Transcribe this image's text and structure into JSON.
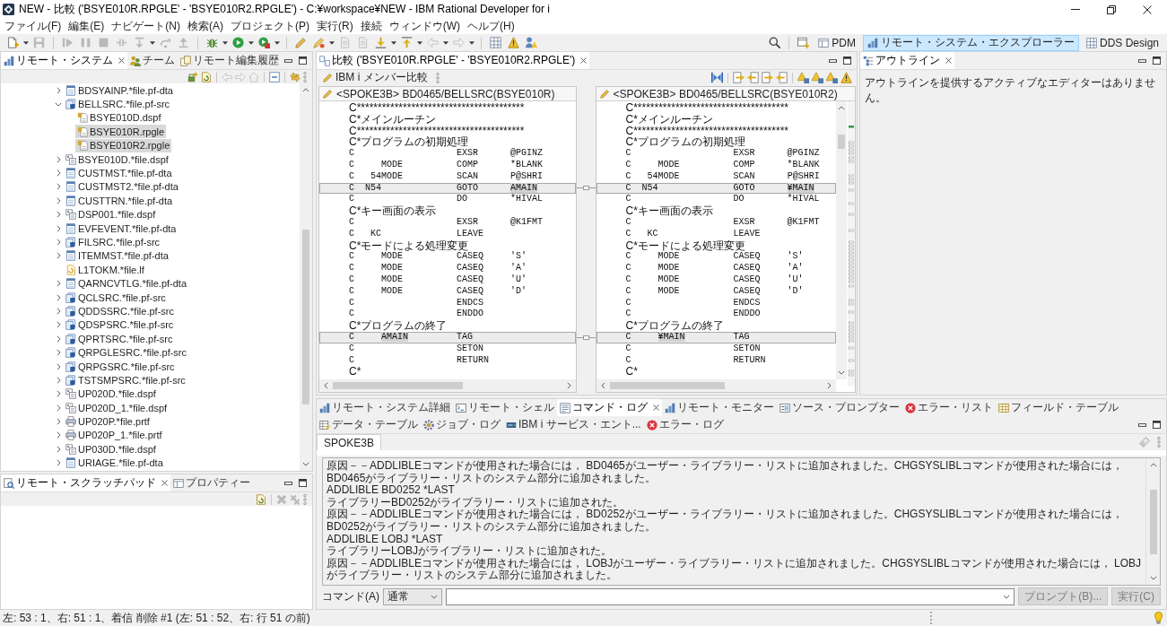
{
  "window": {
    "title": "NEW - 比較 ('BSYE010R.RPGLE' - 'BSYE010R2.RPGLE') - C:¥workspace¥NEW - IBM Rational Developer for i"
  },
  "menu": [
    "ファイル(F)",
    "編集(E)",
    "ナビゲート(N)",
    "検索(A)",
    "プロジェクト(P)",
    "実行(R)",
    "接続",
    "ウィンドウ(W)",
    "ヘルプ(H)"
  ],
  "toolbar": {
    "perspectives": [
      {
        "label": "PDM",
        "selected": false
      },
      {
        "label": "リモート・システム・エクスプローラー",
        "selected": true
      },
      {
        "label": "DDS Design",
        "selected": false
      }
    ]
  },
  "left_panel": {
    "tabs": [
      {
        "label": "リモート・システム",
        "selected": true
      },
      {
        "label": "チーム",
        "selected": false
      },
      {
        "label": "リモート編集履歴",
        "selected": false
      }
    ],
    "tree": [
      {
        "label": "BDSYAINP.*file.pf-dta",
        "kind": "data",
        "expanded": false,
        "selected": false
      },
      {
        "label": "BELLSRC.*file.pf-src",
        "kind": "source",
        "expanded": true,
        "selected": false,
        "children": [
          {
            "label": "BSYE010D.dspf",
            "kind": "member",
            "selected": false
          },
          {
            "label": "BSYE010R.rpgle",
            "kind": "member",
            "selected": true
          },
          {
            "label": "BSYE010R2.rpgle",
            "kind": "member",
            "selected": true
          }
        ]
      },
      {
        "label": "BSYE010D.*file.dspf",
        "kind": "display",
        "expanded": false,
        "selected": false
      },
      {
        "label": "CUSTMST.*file.pf-dta",
        "kind": "data",
        "expanded": false,
        "selected": false
      },
      {
        "label": "CUSTMST2.*file.pf-dta",
        "kind": "data",
        "expanded": false,
        "selected": false
      },
      {
        "label": "CUSTTRN.*file.pf-dta",
        "kind": "data",
        "expanded": false,
        "selected": false
      },
      {
        "label": "DSP001.*file.dspf",
        "kind": "display",
        "expanded": false,
        "selected": false
      },
      {
        "label": "EVFEVENT.*file.pf-dta",
        "kind": "data",
        "expanded": false,
        "selected": false
      },
      {
        "label": "FILSRC.*file.pf-src",
        "kind": "source",
        "expanded": false,
        "selected": false
      },
      {
        "label": "ITEMMST.*file.pf-dta",
        "kind": "data",
        "expanded": false,
        "selected": false
      },
      {
        "label": "L1TOKM.*file.lf",
        "kind": "logical",
        "selected": false
      },
      {
        "label": "QARNCVTLG.*file.pf-dta",
        "kind": "data",
        "expanded": false,
        "selected": false
      },
      {
        "label": "QCLSRC.*file.pf-src",
        "kind": "source",
        "expanded": false,
        "selected": false
      },
      {
        "label": "QDDSSRC.*file.pf-src",
        "kind": "source",
        "expanded": false,
        "selected": false
      },
      {
        "label": "QDSPSRC.*file.pf-src",
        "kind": "source",
        "expanded": false,
        "selected": false
      },
      {
        "label": "QPRTSRC.*file.pf-src",
        "kind": "source",
        "expanded": false,
        "selected": false
      },
      {
        "label": "QRPGLESRC.*file.pf-src",
        "kind": "source",
        "expanded": false,
        "selected": false
      },
      {
        "label": "QRPGSRC.*file.pf-src",
        "kind": "source",
        "expanded": false,
        "selected": false
      },
      {
        "label": "TSTSMPSRC.*file.pf-src",
        "kind": "source",
        "expanded": false,
        "selected": false
      },
      {
        "label": "UP020D.*file.dspf",
        "kind": "display",
        "expanded": false,
        "selected": false
      },
      {
        "label": "UP020D_1.*file.dspf",
        "kind": "display",
        "expanded": false,
        "selected": false
      },
      {
        "label": "UP020P.*file.prtf",
        "kind": "printer",
        "expanded": false,
        "selected": false
      },
      {
        "label": "UP020P_1.*file.prtf",
        "kind": "printer",
        "expanded": false,
        "selected": false
      },
      {
        "label": "UP030D.*file.dspf",
        "kind": "display",
        "expanded": false,
        "selected": false
      },
      {
        "label": "URIAGE.*file.pf-dta",
        "kind": "data",
        "expanded": false,
        "selected": false
      }
    ]
  },
  "scratch_panel": {
    "tabs": [
      {
        "label": "リモート・スクラッチパッド",
        "selected": true
      },
      {
        "label": "プロパティー",
        "selected": false
      }
    ]
  },
  "compare_editor": {
    "tabs": [
      {
        "label": "比較 ('BSYE010R.RPGLE' - 'BSYE010R2.RPGLE')",
        "selected": true
      }
    ],
    "title": "IBM i メンバー比較",
    "panes": [
      {
        "header": "<SPOKE3B> BD0465/BELLSRC(BSYE010R)",
        "lines": [
          {
            "kind": "comment",
            "text": "C****************************************",
            "changed": false
          },
          {
            "kind": "comment",
            "text": "C*メインルーチン",
            "changed": false
          },
          {
            "kind": "comment",
            "text": "C****************************************",
            "changed": false
          },
          {
            "kind": "comment",
            "text": "C*プログラムの初期処理",
            "changed": false
          },
          {
            "kind": "calc",
            "changed": false,
            "tokens": [
              {
                "kind": "spec",
                "text": "C",
                "differs": false
              },
              {
                "kind": "opcode",
                "text": "EXSR",
                "differs": false
              },
              {
                "kind": "factor2",
                "text": "@PGINZ",
                "differs": false
              }
            ]
          },
          {
            "kind": "calc",
            "changed": false,
            "tokens": [
              {
                "kind": "spec",
                "text": "C",
                "differs": false
              },
              {
                "kind": "factor1",
                "text": "MODE",
                "differs": false
              },
              {
                "kind": "opcode",
                "text": "COMP",
                "differs": false
              },
              {
                "kind": "factor2",
                "text": "*BLANK",
                "differs": false
              }
            ]
          },
          {
            "kind": "calc",
            "changed": false,
            "tokens": [
              {
                "kind": "spec",
                "text": "C",
                "differs": false
              },
              {
                "kind": "indicator",
                "text": "54",
                "differs": false
              },
              {
                "kind": "factor1",
                "text": "MODE",
                "differs": false
              },
              {
                "kind": "opcode",
                "text": "SCAN",
                "differs": false
              },
              {
                "kind": "factor2",
                "text": "P@SHRI",
                "differs": false
              }
            ]
          },
          {
            "kind": "calc",
            "changed": true,
            "tokens": [
              {
                "kind": "spec",
                "text": "C",
                "differs": false
              },
              {
                "kind": "indicator",
                "text": "N54",
                "differs": false
              },
              {
                "kind": "opcode",
                "text": "GOTO",
                "differs": false
              },
              {
                "kind": "factor2",
                "text": "AMAIN",
                "differs": true
              }
            ]
          },
          {
            "kind": "calc",
            "changed": false,
            "tokens": [
              {
                "kind": "spec",
                "text": "C",
                "differs": false
              },
              {
                "kind": "opcode",
                "text": "DO",
                "differs": false
              },
              {
                "kind": "factor2",
                "text": "*HIVAL",
                "differs": false
              }
            ]
          },
          {
            "kind": "comment",
            "text": "C*キー画面の表示",
            "changed": false
          },
          {
            "kind": "calc",
            "changed": false,
            "tokens": [
              {
                "kind": "spec",
                "text": "C",
                "differs": false
              },
              {
                "kind": "opcode",
                "text": "EXSR",
                "differs": false
              },
              {
                "kind": "factor2",
                "text": "@K1FMT",
                "differs": false
              }
            ]
          },
          {
            "kind": "calc",
            "changed": false,
            "tokens": [
              {
                "kind": "spec",
                "text": "C",
                "differs": false
              },
              {
                "kind": "indicator",
                "text": "KC",
                "differs": false
              },
              {
                "kind": "opcode",
                "text": "LEAVE",
                "differs": false
              }
            ]
          },
          {
            "kind": "comment",
            "text": "C*モードによる処理変更",
            "changed": false
          },
          {
            "kind": "calc",
            "changed": false,
            "tokens": [
              {
                "kind": "spec",
                "text": "C",
                "differs": false
              },
              {
                "kind": "factor1",
                "text": "MODE",
                "differs": false
              },
              {
                "kind": "opcode",
                "text": "CASEQ",
                "differs": false
              },
              {
                "kind": "factor2",
                "text": "'S'",
                "differs": false
              }
            ]
          },
          {
            "kind": "calc",
            "changed": false,
            "tokens": [
              {
                "kind": "spec",
                "text": "C",
                "differs": false
              },
              {
                "kind": "factor1",
                "text": "MODE",
                "differs": false
              },
              {
                "kind": "opcode",
                "text": "CASEQ",
                "differs": false
              },
              {
                "kind": "factor2",
                "text": "'A'",
                "differs": false
              }
            ]
          },
          {
            "kind": "calc",
            "changed": false,
            "tokens": [
              {
                "kind": "spec",
                "text": "C",
                "differs": false
              },
              {
                "kind": "factor1",
                "text": "MODE",
                "differs": false
              },
              {
                "kind": "opcode",
                "text": "CASEQ",
                "differs": false
              },
              {
                "kind": "factor2",
                "text": "'U'",
                "differs": false
              }
            ]
          },
          {
            "kind": "calc",
            "changed": false,
            "tokens": [
              {
                "kind": "spec",
                "text": "C",
                "differs": false
              },
              {
                "kind": "factor1",
                "text": "MODE",
                "differs": false
              },
              {
                "kind": "opcode",
                "text": "CASEQ",
                "differs": false
              },
              {
                "kind": "factor2",
                "text": "'D'",
                "differs": false
              }
            ]
          },
          {
            "kind": "calc",
            "changed": false,
            "tokens": [
              {
                "kind": "spec",
                "text": "C",
                "differs": false
              },
              {
                "kind": "opcode",
                "text": "ENDCS",
                "differs": false
              }
            ]
          },
          {
            "kind": "calc",
            "changed": false,
            "tokens": [
              {
                "kind": "spec",
                "text": "C",
                "differs": false
              },
              {
                "kind": "opcode",
                "text": "ENDDO",
                "differs": false
              }
            ]
          },
          {
            "kind": "comment",
            "text": "C*プログラムの終了",
            "changed": false
          },
          {
            "kind": "calc",
            "changed": true,
            "tokens": [
              {
                "kind": "spec",
                "text": "C",
                "differs": false
              },
              {
                "kind": "factor1",
                "text": "AMAIN",
                "differs": true
              },
              {
                "kind": "opcode",
                "text": "TAG",
                "differs": false
              }
            ]
          },
          {
            "kind": "calc",
            "changed": false,
            "tokens": [
              {
                "kind": "spec",
                "text": "C",
                "differs": false
              },
              {
                "kind": "opcode",
                "text": "SETON",
                "differs": false
              }
            ]
          },
          {
            "kind": "calc",
            "changed": false,
            "tokens": [
              {
                "kind": "spec",
                "text": "C",
                "differs": false
              },
              {
                "kind": "opcode",
                "text": "RETURN",
                "differs": false
              }
            ]
          },
          {
            "kind": "comment",
            "text": "C*",
            "changed": false
          }
        ]
      },
      {
        "header": "<SPOKE3B> BD0465/BELLSRC(BSYE010R2)",
        "lines": [
          {
            "kind": "comment",
            "text": "C*************************************",
            "changed": false
          },
          {
            "kind": "comment",
            "text": "C*メインルーチン",
            "changed": false
          },
          {
            "kind": "comment",
            "text": "C*************************************",
            "changed": false
          },
          {
            "kind": "comment",
            "text": "C*プログラムの初期処理",
            "changed": false
          },
          {
            "kind": "calc",
            "changed": false,
            "tokens": [
              {
                "kind": "spec",
                "text": "C",
                "differs": false
              },
              {
                "kind": "opcode",
                "text": "EXSR",
                "differs": false
              },
              {
                "kind": "factor2",
                "text": "@PGINZ",
                "differs": false
              }
            ]
          },
          {
            "kind": "calc",
            "changed": false,
            "tokens": [
              {
                "kind": "spec",
                "text": "C",
                "differs": false
              },
              {
                "kind": "factor1",
                "text": "MODE",
                "differs": false
              },
              {
                "kind": "opcode",
                "text": "COMP",
                "differs": false
              },
              {
                "kind": "factor2",
                "text": "*BLANK",
                "differs": false
              }
            ]
          },
          {
            "kind": "calc",
            "changed": false,
            "tokens": [
              {
                "kind": "spec",
                "text": "C",
                "differs": false
              },
              {
                "kind": "indicator",
                "text": "54",
                "differs": false
              },
              {
                "kind": "factor1",
                "text": "MODE",
                "differs": false
              },
              {
                "kind": "opcode",
                "text": "SCAN",
                "differs": false
              },
              {
                "kind": "factor2",
                "text": "P@SHRI",
                "differs": false
              }
            ]
          },
          {
            "kind": "calc",
            "changed": true,
            "tokens": [
              {
                "kind": "spec",
                "text": "C",
                "differs": false
              },
              {
                "kind": "indicator",
                "text": "N54",
                "differs": false
              },
              {
                "kind": "opcode",
                "text": "GOTO",
                "differs": false
              },
              {
                "kind": "factor2",
                "text": "¥MAIN",
                "differs": true
              }
            ]
          },
          {
            "kind": "calc",
            "changed": false,
            "tokens": [
              {
                "kind": "spec",
                "text": "C",
                "differs": false
              },
              {
                "kind": "opcode",
                "text": "DO",
                "differs": false
              },
              {
                "kind": "factor2",
                "text": "*HIVAL",
                "differs": false
              }
            ]
          },
          {
            "kind": "comment",
            "text": "C*キー画面の表示",
            "changed": false
          },
          {
            "kind": "calc",
            "changed": false,
            "tokens": [
              {
                "kind": "spec",
                "text": "C",
                "differs": false
              },
              {
                "kind": "opcode",
                "text": "EXSR",
                "differs": false
              },
              {
                "kind": "factor2",
                "text": "@K1FMT",
                "differs": false
              }
            ]
          },
          {
            "kind": "calc",
            "changed": false,
            "tokens": [
              {
                "kind": "spec",
                "text": "C",
                "differs": false
              },
              {
                "kind": "indicator",
                "text": "KC",
                "differs": false
              },
              {
                "kind": "opcode",
                "text": "LEAVE",
                "differs": false
              }
            ]
          },
          {
            "kind": "comment",
            "text": "C*モードによる処理変更",
            "changed": false
          },
          {
            "kind": "calc",
            "changed": false,
            "tokens": [
              {
                "kind": "spec",
                "text": "C",
                "differs": false
              },
              {
                "kind": "factor1",
                "text": "MODE",
                "differs": false
              },
              {
                "kind": "opcode",
                "text": "CASEQ",
                "differs": false
              },
              {
                "kind": "factor2",
                "text": "'S'",
                "differs": false
              }
            ]
          },
          {
            "kind": "calc",
            "changed": false,
            "tokens": [
              {
                "kind": "spec",
                "text": "C",
                "differs": false
              },
              {
                "kind": "factor1",
                "text": "MODE",
                "differs": false
              },
              {
                "kind": "opcode",
                "text": "CASEQ",
                "differs": false
              },
              {
                "kind": "factor2",
                "text": "'A'",
                "differs": false
              }
            ]
          },
          {
            "kind": "calc",
            "changed": false,
            "tokens": [
              {
                "kind": "spec",
                "text": "C",
                "differs": false
              },
              {
                "kind": "factor1",
                "text": "MODE",
                "differs": false
              },
              {
                "kind": "opcode",
                "text": "CASEQ",
                "differs": false
              },
              {
                "kind": "factor2",
                "text": "'U'",
                "differs": false
              }
            ]
          },
          {
            "kind": "calc",
            "changed": false,
            "tokens": [
              {
                "kind": "spec",
                "text": "C",
                "differs": false
              },
              {
                "kind": "factor1",
                "text": "MODE",
                "differs": false
              },
              {
                "kind": "opcode",
                "text": "CASEQ",
                "differs": false
              },
              {
                "kind": "factor2",
                "text": "'D'",
                "differs": false
              }
            ]
          },
          {
            "kind": "calc",
            "changed": false,
            "tokens": [
              {
                "kind": "spec",
                "text": "C",
                "differs": false
              },
              {
                "kind": "opcode",
                "text": "ENDCS",
                "differs": false
              }
            ]
          },
          {
            "kind": "calc",
            "changed": false,
            "tokens": [
              {
                "kind": "spec",
                "text": "C",
                "differs": false
              },
              {
                "kind": "opcode",
                "text": "ENDDO",
                "differs": false
              }
            ]
          },
          {
            "kind": "comment",
            "text": "C*プログラムの終了",
            "changed": false
          },
          {
            "kind": "calc",
            "changed": true,
            "tokens": [
              {
                "kind": "spec",
                "text": "C",
                "differs": false
              },
              {
                "kind": "factor1",
                "text": "¥MAIN",
                "differs": true
              },
              {
                "kind": "opcode",
                "text": "TAG",
                "differs": false
              }
            ]
          },
          {
            "kind": "calc",
            "changed": false,
            "tokens": [
              {
                "kind": "spec",
                "text": "C",
                "differs": false
              },
              {
                "kind": "opcode",
                "text": "SETON",
                "differs": false
              }
            ]
          },
          {
            "kind": "calc",
            "changed": false,
            "tokens": [
              {
                "kind": "spec",
                "text": "C",
                "differs": false
              },
              {
                "kind": "opcode",
                "text": "RETURN",
                "differs": false
              }
            ]
          },
          {
            "kind": "comment",
            "text": "C*",
            "changed": false
          }
        ]
      }
    ]
  },
  "outline_panel": {
    "tabs": [
      {
        "label": "アウトライン",
        "selected": true
      }
    ],
    "message": "アウトラインを提供するアクティブなエディターはありません。"
  },
  "console_panel": {
    "tabs": [
      {
        "label": "リモート・システム詳細",
        "selected": false
      },
      {
        "label": "リモート・シェル",
        "selected": false
      },
      {
        "label": "コマンド・ログ",
        "selected": true
      },
      {
        "label": "リモート・モニター",
        "selected": false
      },
      {
        "label": "ソース・プロンプター",
        "selected": false
      },
      {
        "label": "エラー・リスト",
        "selected": false
      },
      {
        "label": "フィールド・テーブル",
        "selected": false
      },
      {
        "label": "データ・テーブル",
        "selected": false
      },
      {
        "label": "ジョブ・ログ",
        "selected": false
      },
      {
        "label": "IBM i サービス・エント...",
        "selected": false
      },
      {
        "label": "エラー・ログ",
        "selected": false
      }
    ],
    "sessions": [
      {
        "label": "SPOKE3B",
        "selected": true
      }
    ],
    "log": [
      "原因－－ADDLIBLEコマンドが使用された場合には， BD0465がユーザー・ライブラリー・リストに追加されました。CHGSYSLIBLコマンドが使用された場合には， BD0465がライブラリー・リストのシステム部分に追加されました。",
      "ADDLIBLE BD0252 *LAST",
      "ライブラリーBD0252がライブラリー・リストに追加された。",
      "原因－－ADDLIBLEコマンドが使用された場合には， BD0252がユーザー・ライブラリー・リストに追加されました。CHGSYSLIBLコマンドが使用された場合には， BD0252がライブラリー・リストのシステム部分に追加されました。",
      "ADDLIBLE LOBJ *LAST",
      "ライブラリーLOBJがライブラリー・リストに追加された。",
      "原因－－ADDLIBLEコマンドが使用された場合には， LOBJがユーザー・ライブラリー・リストに追加されました。CHGSYSLIBLコマンドが使用された場合には， LOBJがライブラリー・リストのシステム部分に追加されました。"
    ],
    "command": {
      "label": "コマンド(A)",
      "mode": "通常",
      "prompt_button": {
        "label": "プロンプト(B)...",
        "disabled": true
      },
      "run_button": {
        "label": "実行(C)",
        "disabled": true
      }
    }
  },
  "status_bar": {
    "text": "左: 53 : 1、右: 51 : 1、着信 削除 #1 (左: 51 : 52、右: 行 51 の前)"
  }
}
